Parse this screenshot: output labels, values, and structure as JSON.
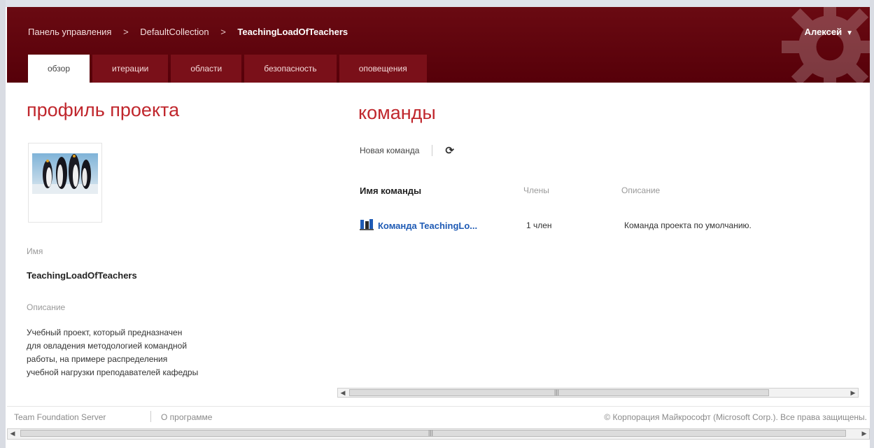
{
  "header": {
    "breadcrumb": [
      "Панель управления",
      "DefaultCollection",
      "TeachingLoadOfTeachers"
    ],
    "separator": ">",
    "user": "Алексей",
    "tabs": [
      "обзор",
      "итерации",
      "области",
      "безопасность",
      "оповещения"
    ],
    "active_tab": "обзор",
    "brand_color": "#5e0610"
  },
  "profile": {
    "title": "профиль проекта",
    "name_label": "Имя",
    "name_value": "TeachingLoadOfTeachers",
    "description_label": "Описание",
    "description_lines": [
      "Учебный проект, который предназначен",
      "для овладения методологией командной",
      "работы, на примере распределения",
      "учебной нагрузки преподавателей кафедры"
    ]
  },
  "teams": {
    "title": "команды",
    "new_team_label": "Новая команда",
    "refresh_icon": "refresh-icon",
    "columns": [
      "Имя команды",
      "Члены",
      "Описание"
    ],
    "rows": [
      {
        "name": "Команда TeachingLo...",
        "members": "1 член",
        "description": "Команда проекта по умолчанию."
      }
    ]
  },
  "footer": {
    "product": "Team Foundation Server",
    "about": "О программе",
    "copyright": "© Корпорация Майкрософт (Microsoft Corp.). Все права защищены."
  },
  "accent_color": "#c0272d"
}
